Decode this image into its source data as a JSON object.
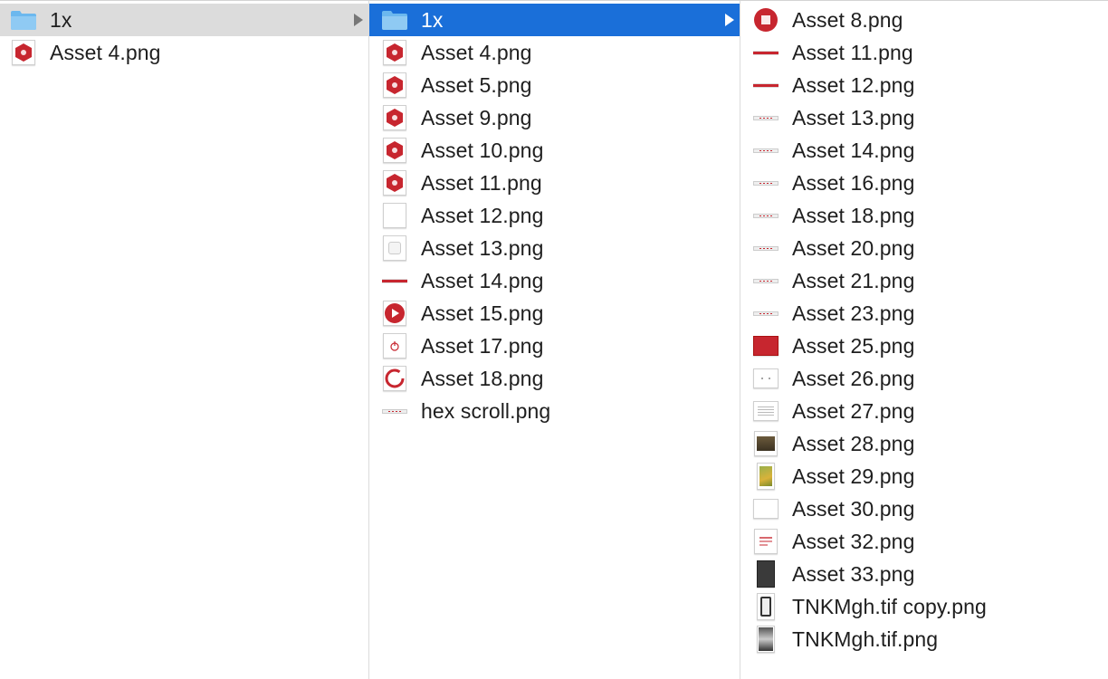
{
  "columns": {
    "col1": [
      {
        "label": "1x",
        "icon": "folder-icon",
        "selected": "inactive",
        "has_arrow": true
      },
      {
        "label": "Asset 4.png",
        "icon": "hex-red-icon"
      }
    ],
    "col2": [
      {
        "label": "1x",
        "icon": "folder-icon",
        "selected": "active",
        "has_arrow": true
      },
      {
        "label": "Asset 4.png",
        "icon": "hex-red-icon"
      },
      {
        "label": "Asset 5.png",
        "icon": "hex-red-icon"
      },
      {
        "label": "Asset 9.png",
        "icon": "hex-red-icon"
      },
      {
        "label": "Asset 10.png",
        "icon": "hex-red-icon"
      },
      {
        "label": "Asset 11.png",
        "icon": "hex-red-icon"
      },
      {
        "label": "Asset 12.png",
        "icon": "blank-thumbnail-icon"
      },
      {
        "label": "Asset 13.png",
        "icon": "light-thumbnail-icon"
      },
      {
        "label": "Asset 14.png",
        "icon": "bar-thumbnail-icon"
      },
      {
        "label": "Asset 15.png",
        "icon": "play-red-icon"
      },
      {
        "label": "Asset 17.png",
        "icon": "power-thumbnail-icon"
      },
      {
        "label": "Asset 18.png",
        "icon": "ring-red-icon"
      },
      {
        "label": "hex scroll.png",
        "icon": "dotted-bar-thumbnail-icon"
      }
    ],
    "col3": [
      {
        "label": "Asset 8.png",
        "icon": "circle-red-icon"
      },
      {
        "label": "Asset 11.png",
        "icon": "bar-thumbnail-icon"
      },
      {
        "label": "Asset 12.png",
        "icon": "bar-thumbnail-icon"
      },
      {
        "label": "Asset 13.png",
        "icon": "dotted-bar-thumbnail-icon"
      },
      {
        "label": "Asset 14.png",
        "icon": "dotted-bar-thumbnail-icon"
      },
      {
        "label": "Asset 16.png",
        "icon": "dotted-bar-thumbnail-icon"
      },
      {
        "label": "Asset 18.png",
        "icon": "dotted-bar-thumbnail-icon"
      },
      {
        "label": "Asset 20.png",
        "icon": "dotted-bar-thumbnail-icon"
      },
      {
        "label": "Asset 21.png",
        "icon": "dotted-bar-thumbnail-icon"
      },
      {
        "label": "Asset 23.png",
        "icon": "dotted-bar-thumbnail-icon"
      },
      {
        "label": "Asset 25.png",
        "icon": "red-box-thumbnail-icon"
      },
      {
        "label": "Asset 26.png",
        "icon": "dots-thumbnail-icon"
      },
      {
        "label": "Asset 27.png",
        "icon": "lines-thumbnail-icon"
      },
      {
        "label": "Asset 28.png",
        "icon": "photo-thumbnail-icon"
      },
      {
        "label": "Asset 29.png",
        "icon": "green-photo-thumbnail-icon"
      },
      {
        "label": "Asset 30.png",
        "icon": "blank-wide-thumbnail-icon"
      },
      {
        "label": "Asset 32.png",
        "icon": "text-red-thumbnail-icon"
      },
      {
        "label": "Asset 33.png",
        "icon": "dark-tall-thumbnail-icon"
      },
      {
        "label": "TNKMgh.tif copy.png",
        "icon": "phone-thumbnail-icon"
      },
      {
        "label": "TNKMgh.tif.png",
        "icon": "gradient-tall-thumbnail-icon"
      }
    ]
  },
  "colors": {
    "selection_active": "#1a6fd9",
    "selection_inactive": "#dcdcdc",
    "folder_blue": "#6cb8ee",
    "accent_red": "#c7262f"
  }
}
